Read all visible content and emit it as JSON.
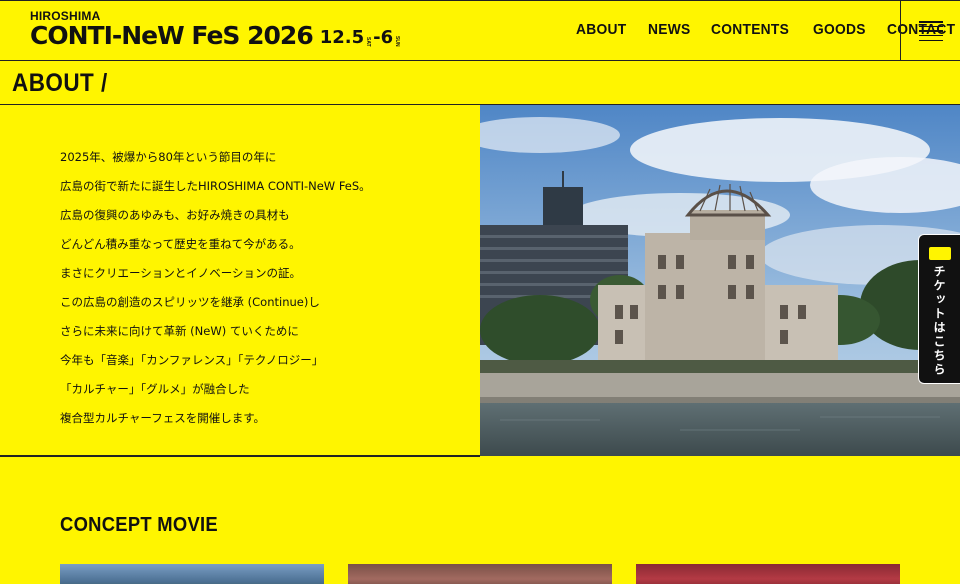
{
  "header": {
    "logo_top": "HIROSHIMA",
    "logo_main": "CONTI-NeW FeS 2026",
    "date_start": "12.5",
    "day_start": "SAT",
    "date_sep": "-",
    "date_end": "6",
    "day_end": "SUN",
    "nav": [
      {
        "label": "ABOUT"
      },
      {
        "label": "NEWS"
      },
      {
        "label": "CONTENTS"
      },
      {
        "label": "GOODS"
      },
      {
        "label": "CONTACT"
      }
    ]
  },
  "section": {
    "title": "ABOUT /"
  },
  "about": {
    "lines": [
      "2025年、被爆から80年という節目の年に",
      "広島の街で新たに誕生したHIROSHIMA CONTI-NeW FeS。",
      "広島の復興のあゆみも、お好み焼きの具材も",
      "どんどん積み重なって歴史を重ねて今がある。",
      "まさにクリエーションとイノベーションの証。",
      "この広島の創造のスピリッツを継承 (Continue)し",
      "さらに未来に向けて革新 (NeW) ていくために",
      "今年も「音楽」「カンファレンス」「テクノロジー」",
      "「カルチャー」「グルメ」が融合した",
      "複合型カルチャーフェスを開催します。"
    ]
  },
  "ticket": {
    "label": "チケットはこちら"
  },
  "concept": {
    "title": "CONCEPT MOVIE"
  },
  "colors": {
    "background": "#FFF500",
    "ink": "#111111"
  }
}
